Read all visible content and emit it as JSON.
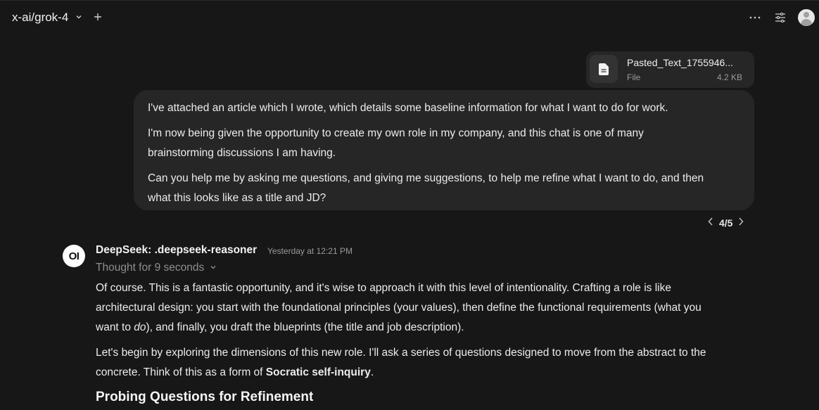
{
  "header": {
    "model_name": "x-ai/grok-4",
    "icons": [
      "chevron-down-icon",
      "plus-icon",
      "more-icon",
      "sliders-icon",
      "user-avatar-icon"
    ]
  },
  "attachment": {
    "name": "Pasted_Text_1755946...",
    "type": "File",
    "size": "4.2 KB"
  },
  "user_message": {
    "p1": "I've attached an article which I wrote, which details some baseline information for what I want to do for work.",
    "p2a": "I'm now being given the opportunity to create my own role in my company, and this chat is one of many",
    "p2b": "brainstorming discussions I am having.",
    "p3a": "Can you help me by asking me questions, and giving me suggestions, to help me refine what I want to do, and then",
    "p3b": "what this looks like as a title and JD?"
  },
  "pager": {
    "label": "4/5"
  },
  "assistant": {
    "logo_text": "OI",
    "name": "DeepSeek: .deepseek-reasoner",
    "time": "Yesterday at 12:21 PM",
    "thought": "Thought for 9 seconds",
    "a1_line1": "Of course. This is a fantastic opportunity, and it's wise to approach it with this level of intentionality. Crafting a role is like",
    "a1_line2": "architectural design: you start with the foundational principles (your values), then define the functional requirements (what you",
    "a1_line3_pre": "want to ",
    "a1_line3_em": "do",
    "a1_line3_post": "), and finally, you draft the blueprints (the title and job description).",
    "a2_line1": "Let's begin by exploring the dimensions of this new role. I'll ask a series of questions designed to move from the abstract to the",
    "a2_line2_pre": "concrete. Think of this as a form of ",
    "a2_line2_bold": "Socratic self-inquiry",
    "a2_line2_post": ".",
    "heading": "Probing Questions for Refinement"
  }
}
